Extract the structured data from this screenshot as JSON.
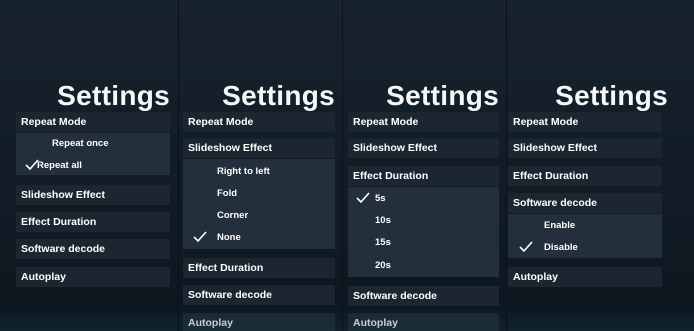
{
  "panels": [
    {
      "title": "Settings",
      "menu": [
        "Repeat Mode",
        "Slideshow Effect",
        "Effect Duration",
        "Software decode",
        "Autoplay"
      ],
      "submenu": {
        "parent": "Repeat Mode",
        "options": [
          "Repeat once",
          "Repeat all"
        ],
        "selected": "Repeat all"
      }
    },
    {
      "title": "Settings",
      "menu": [
        "Repeat Mode",
        "Slideshow Effect",
        "Effect Duration",
        "Software decode",
        "Autoplay"
      ],
      "submenu": {
        "parent": "Slideshow Effect",
        "options": [
          "Right to left",
          "Fold",
          "Corner",
          "None"
        ],
        "selected": "None"
      }
    },
    {
      "title": "Settings",
      "menu": [
        "Repeat Mode",
        "Slideshow Effect",
        "Effect Duration",
        "Software decode",
        "Autoplay"
      ],
      "submenu": {
        "parent": "Effect Duration",
        "options": [
          "5s",
          "10s",
          "15s",
          "20s"
        ],
        "selected": "5s"
      }
    },
    {
      "title": "Settings",
      "menu": [
        "Repeat Mode",
        "Slideshow Effect",
        "Effect Duration",
        "Software decode",
        "Autoplay"
      ],
      "submenu": {
        "parent": "Software decode",
        "options": [
          "Enable",
          "Disable"
        ],
        "selected": "Disable"
      }
    }
  ],
  "icons": {
    "check": "checkmark-icon"
  },
  "colors": {
    "background": "#121d27",
    "item": "#1b2630",
    "submenu": "#23303b",
    "text": "#ffffff"
  }
}
